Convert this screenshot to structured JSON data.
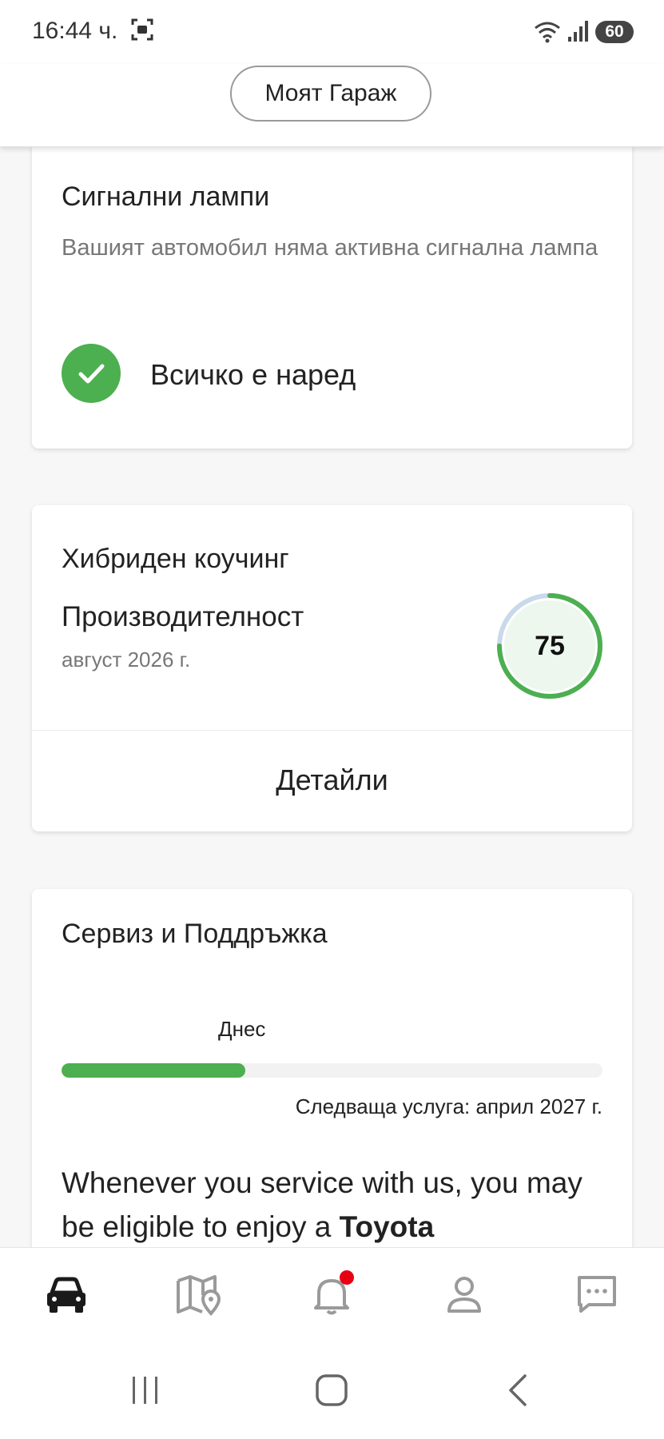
{
  "status_bar": {
    "time": "16:44 ч.",
    "battery": "60"
  },
  "header": {
    "garage_button": "Моят Гараж"
  },
  "warning_lights": {
    "title": "Сигнални лампи",
    "description": "Вашият автомобил няма активна сигнална лампа",
    "status": "Всичко е наред"
  },
  "hybrid_coaching": {
    "title": "Хибриден коучинг",
    "metric_label": "Производителност",
    "period": "август 2026 г.",
    "score": "75",
    "score_fraction": 0.75,
    "details_button": "Детайли"
  },
  "service": {
    "title": "Сервиз и Поддръжка",
    "today_label": "Днес",
    "progress_fraction": 0.34,
    "next_service": "Следваща услуга: април 2027 г.",
    "promo_text": "Whenever you service with us, you may be eligible to enjoy a ",
    "promo_brand": "Toyota"
  },
  "tab_bar": {
    "items": [
      "car-icon",
      "map-icon",
      "bell-icon",
      "profile-icon",
      "chat-icon"
    ],
    "active": "car-icon"
  },
  "colors": {
    "accent_green": "#4caf50",
    "notification_red": "#e60012",
    "score_remaining": "#c9d9ea"
  }
}
